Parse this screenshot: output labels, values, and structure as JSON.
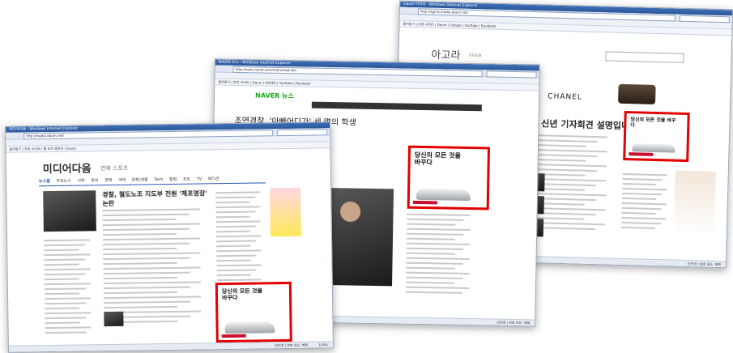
{
  "colors": {
    "ad_border": "#e30000",
    "daum_blue": "#2857b8",
    "naver_green": "#19a918",
    "title_bar": "#2b5799"
  },
  "win1": {
    "title": "미디어다음 - Windows Internet Explorer",
    "url": "http://media.daum.net/",
    "favorites": "즐겨찾기  |  추천 사이트  |  웹 조각 갤러리  |  Daum",
    "logo": "미디어다음",
    "logo_sub": "연예 스포츠",
    "nav": [
      "뉴스홈",
      "주요뉴스",
      "사회",
      "정치",
      "경제",
      "국제",
      "문화/생활",
      "Tech",
      "칼럼",
      "포토",
      "TV",
      "에디션"
    ],
    "headline": "경찰, 철도노조 지도부 전원 '체포영장'",
    "headline2": "논란",
    "ad_text": "당신의 모든 것을 바꾸다",
    "status": "인터넷 | 보호 모드: 해제",
    "zoom": "100%"
  },
  "win2": {
    "title": "NAVER 뉴스 - Windows Internet Explorer",
    "url": "http://news.naver.com/main/read.nhn",
    "favorites": "즐겨찾기  |  추천 사이트  |  Daum  |  NAVER  |  YouTube  |  Facebook",
    "logo": "NAVER 뉴스",
    "headline": "조연경찰, '아빠어디가' 세 명의 학생",
    "ad_text": "당신의 모든 것을 바꾸다",
    "status": "인터넷 | 보호 모드: 해제"
  },
  "win3": {
    "title": "Daum 아고라 - Windows Internet Explorer",
    "url": "http://agora.media.daum.net/",
    "favorites": "즐겨찾기  |  추천 사이트  |  Daum  |  Google  |  YouTube  |  Facebook",
    "logo": "아고라",
    "logo_sub": "view",
    "brand": "CHANEL",
    "headline": "가 본 신년 기자회견 설명입니다",
    "ad_text": "당신의 모든 것을 바꾸다",
    "status": "인터넷 | 보호 모드: 해제"
  }
}
